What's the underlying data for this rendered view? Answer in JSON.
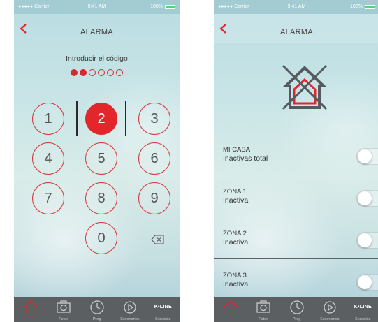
{
  "colors": {
    "accent": "#e3262c",
    "tab_bar": "#5b5f62"
  },
  "status_bar": {
    "carrier": "●●●●● Carrier",
    "time": "9:41 AM",
    "battery": "100%"
  },
  "screen_code": {
    "title": "ALARMA",
    "prompt": "Introducir el código",
    "code_digits_entered": 2,
    "code_length": 6,
    "keypad": [
      "1",
      "2",
      "3",
      "4",
      "5",
      "6",
      "7",
      "8",
      "9",
      "0"
    ],
    "active_key": "2"
  },
  "screen_zones": {
    "title": "ALARMA",
    "zones": [
      {
        "name": "MI CASA",
        "status": "Inactivas total",
        "enabled": false
      },
      {
        "name": "ZONA 1",
        "status": "Inactiva",
        "enabled": false
      },
      {
        "name": "ZONA 2",
        "status": "Inactiva",
        "enabled": false
      },
      {
        "name": "ZONA 3",
        "status": "Inactiva",
        "enabled": false
      }
    ]
  },
  "tab_bar": {
    "tabs": [
      {
        "id": "home",
        "label": "",
        "icon": "home-icon"
      },
      {
        "id": "fotos",
        "label": "Fotos",
        "icon": "camera-icon"
      },
      {
        "id": "prog",
        "label": "Prog",
        "icon": "clock-icon"
      },
      {
        "id": "escenarios",
        "label": "Escenarios",
        "icon": "play-icon"
      },
      {
        "id": "servicios",
        "label": "Servicios",
        "icon": "kline-logo",
        "logo_text": "K•LINE"
      }
    ],
    "selected": "home"
  }
}
